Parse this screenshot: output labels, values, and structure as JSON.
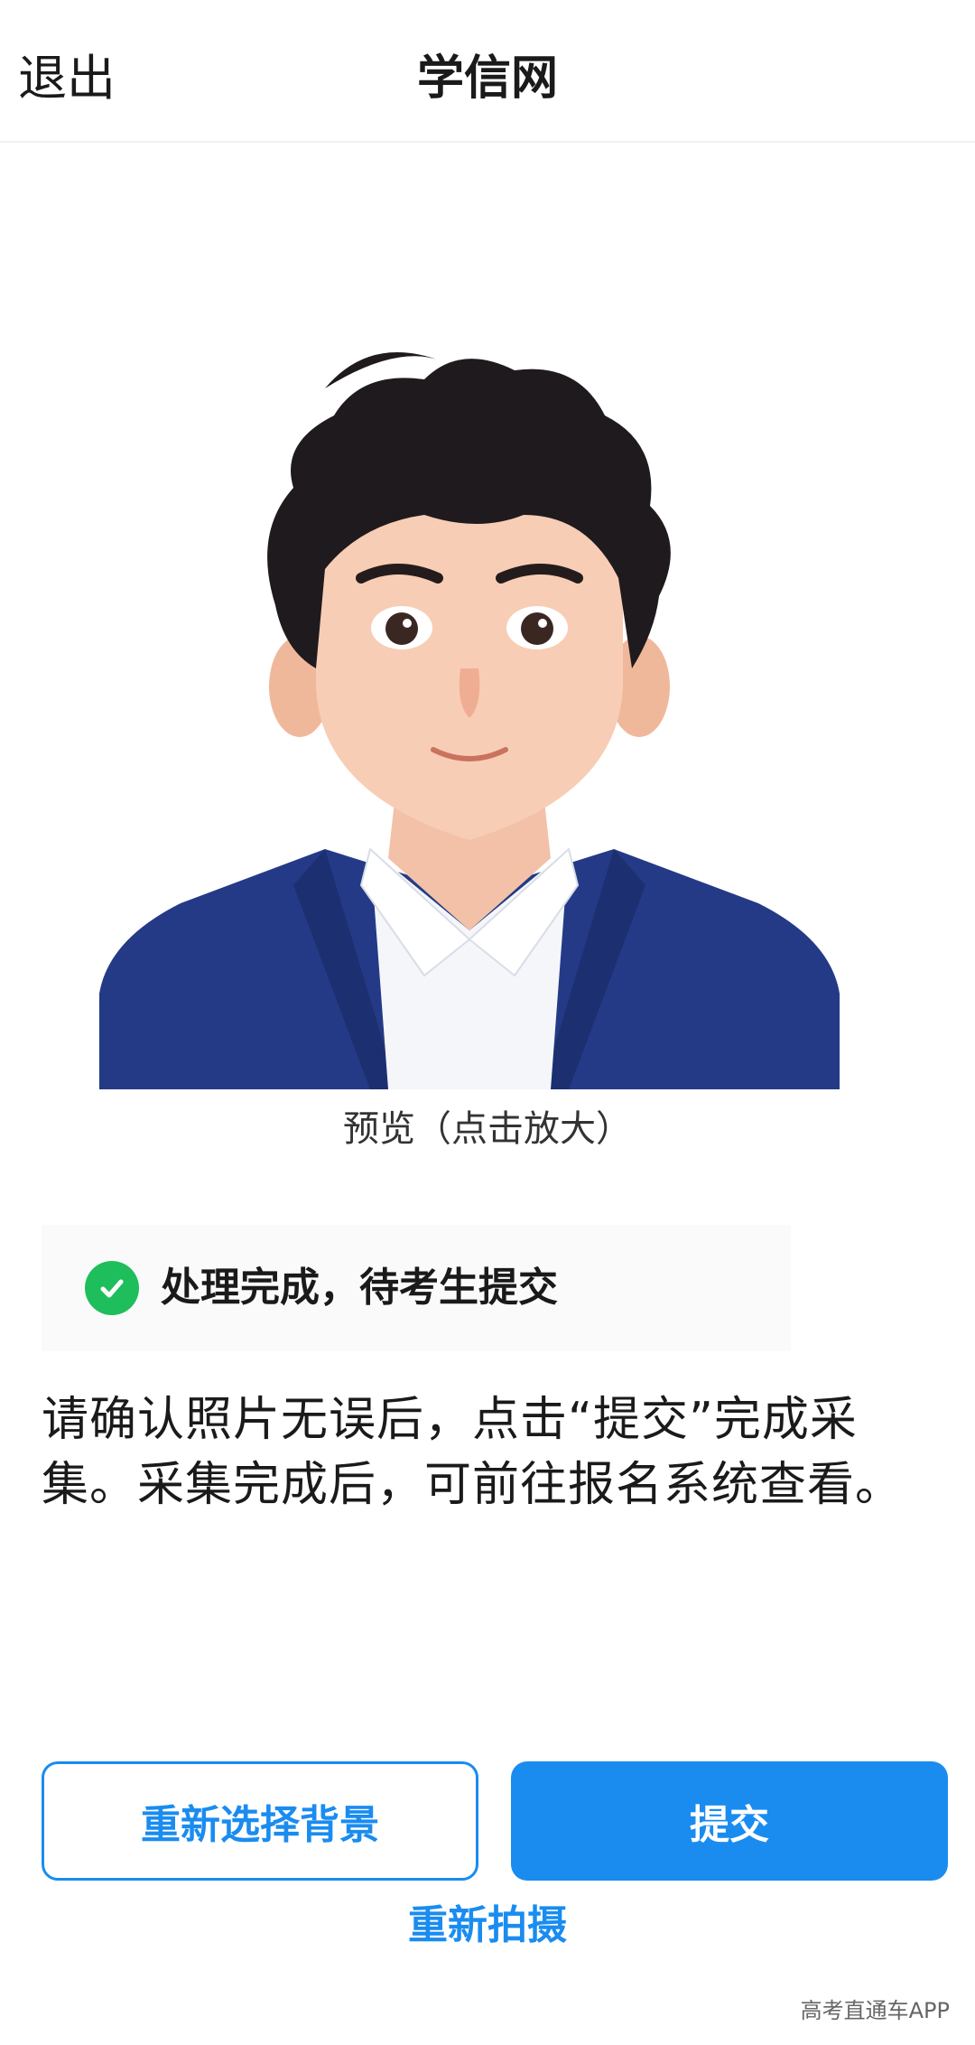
{
  "header": {
    "exit_label": "退出",
    "title": "学信网"
  },
  "photo": {
    "caption": "预览（点击放大）"
  },
  "status": {
    "text": "处理完成，待考生提交",
    "icon": "check-circle-icon",
    "color": "#1fbe5c"
  },
  "instruction": {
    "text": "请确认照片无误后，点击“提交”完成采集。采集完成后，可前往报名系统查看。"
  },
  "actions": {
    "reselect_background_label": "重新选择背景",
    "submit_label": "提交",
    "retake_label": "重新拍摄",
    "accent_color": "#1a8cf0"
  },
  "watermark": {
    "text": "高考直通车APP"
  }
}
